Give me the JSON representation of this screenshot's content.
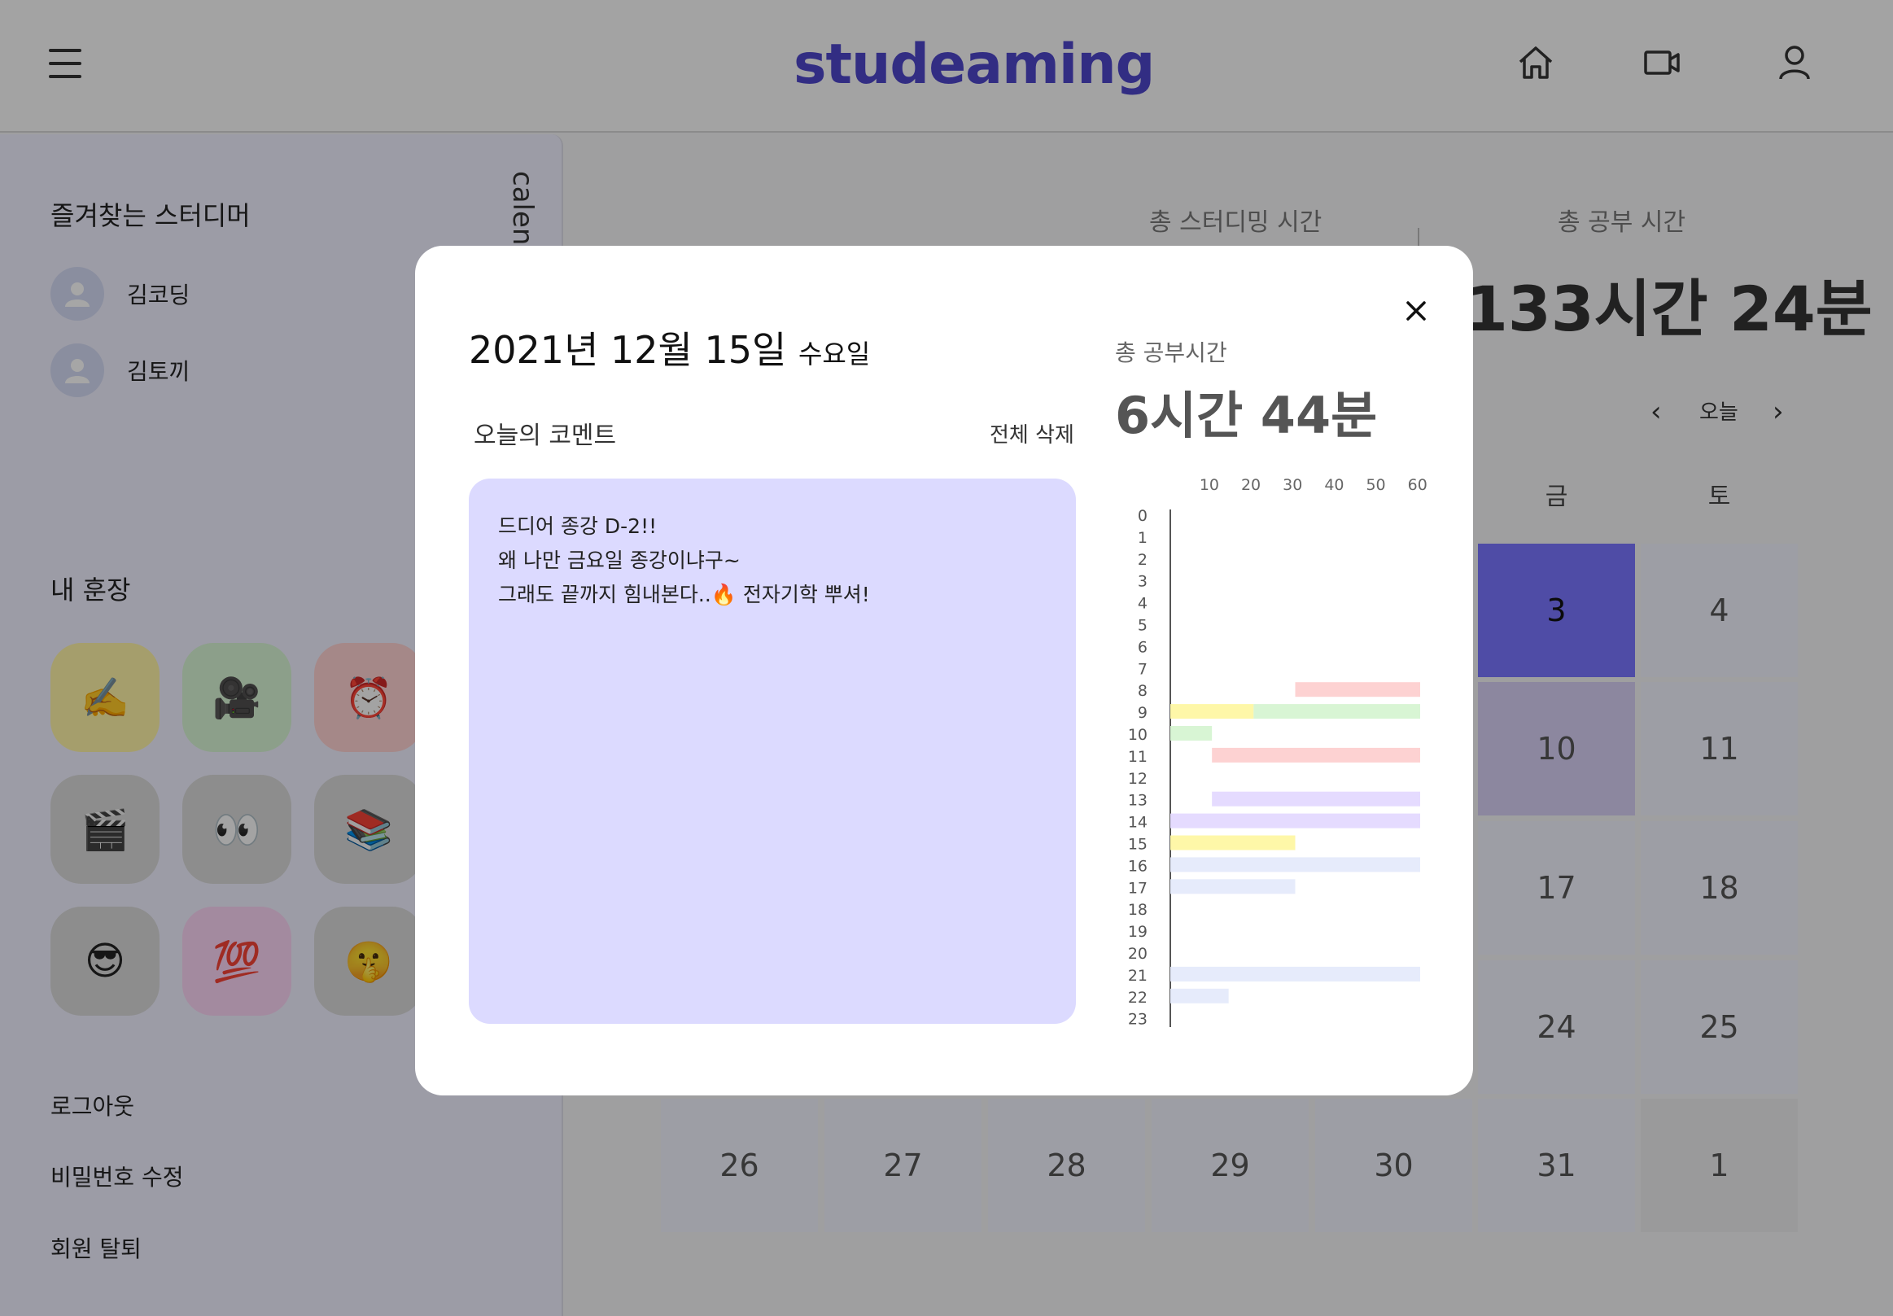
{
  "header": {
    "logo": "studeaming"
  },
  "sidebar": {
    "calendar_tab": "calendar",
    "favorites_title": "즐겨찾는 스터디머",
    "favorites": [
      {
        "name": "김코딩"
      },
      {
        "name": "김토끼"
      }
    ],
    "stamps_title": "내 훈장",
    "stamps": [
      {
        "emoji": "✍️",
        "color": "#fef3a6"
      },
      {
        "emoji": "🎥",
        "color": "#d8f5d4"
      },
      {
        "emoji": "⏰",
        "color": "#fdd2d2"
      },
      {
        "emoji": "🎬",
        "color": "#d9d9d9"
      },
      {
        "emoji": "👀",
        "color": "#d9d9d9"
      },
      {
        "emoji": "📚",
        "color": "#d9d9d9"
      },
      {
        "emoji": "😎",
        "color": "#d9d9d9"
      },
      {
        "emoji": "💯",
        "color": "#fbd4f4"
      },
      {
        "emoji": "🤫",
        "color": "#d9d9d9"
      }
    ],
    "menu": {
      "logout": "로그아웃",
      "change_password": "비밀번호 수정",
      "withdraw": "회원 탈퇴"
    }
  },
  "main": {
    "stat_studeaming_label": "총 스터디밍 시간",
    "stat_study_label": "총 공부 시간",
    "stat_study_value": "133시간 24분",
    "today_button": "오늘",
    "weekdays": {
      "fri": "금",
      "sat": "토"
    },
    "cells": [
      {
        "day": "3",
        "level": "high"
      },
      {
        "day": "4",
        "level": "none"
      },
      {
        "day": "10",
        "level": "mid"
      },
      {
        "day": "11",
        "level": "none"
      },
      {
        "day": "17",
        "level": "none"
      },
      {
        "day": "18",
        "level": "none"
      },
      {
        "day": "24",
        "level": "none"
      },
      {
        "day": "25",
        "level": "none"
      },
      {
        "day": "26",
        "level": "none"
      },
      {
        "day": "27",
        "level": "none"
      },
      {
        "day": "28",
        "level": "none"
      },
      {
        "day": "29",
        "level": "none"
      },
      {
        "day": "30",
        "level": "none"
      },
      {
        "day": "31",
        "level": "none"
      },
      {
        "day": "1",
        "level": "other"
      }
    ],
    "colors": {
      "high": "#7a75ff",
      "mid": "#d8d0f5",
      "none": "#f2f3fd",
      "other": "#ededef"
    }
  },
  "modal": {
    "date": "2021년 12월 15일",
    "weekday": "수요일",
    "comment_title": "오늘의 코멘트",
    "delete_all": "전체 삭제",
    "comment_lines": [
      "드디어 종강 D-2!!",
      "왜 나만 금요일 종강이냐구~",
      "그래도 끝까지 힘내본다..🔥 전자기학 뿌셔!"
    ],
    "total_label": "총 공부시간",
    "total_value": "6시간 44분"
  },
  "chart_data": {
    "type": "bar",
    "orientation": "horizontal",
    "xlim": [
      0,
      60
    ],
    "x_ticks": [
      "10",
      "20",
      "30",
      "40",
      "50",
      "60"
    ],
    "y_categories": [
      "0",
      "1",
      "2",
      "3",
      "4",
      "5",
      "6",
      "7",
      "8",
      "9",
      "10",
      "11",
      "12",
      "13",
      "14",
      "15",
      "16",
      "17",
      "18",
      "19",
      "20",
      "21",
      "22",
      "23"
    ],
    "segments": [
      {
        "hour": 8,
        "start": 30,
        "end": 60,
        "color": "#fdd2d2"
      },
      {
        "hour": 9,
        "start": 0,
        "end": 20,
        "color": "#fef7a8"
      },
      {
        "hour": 9,
        "start": 20,
        "end": 60,
        "color": "#d8f5d4"
      },
      {
        "hour": 10,
        "start": 0,
        "end": 10,
        "color": "#d8f5d4"
      },
      {
        "hour": 11,
        "start": 10,
        "end": 60,
        "color": "#fdd2d2"
      },
      {
        "hour": 13,
        "start": 10,
        "end": 60,
        "color": "#e5dbff"
      },
      {
        "hour": 14,
        "start": 0,
        "end": 60,
        "color": "#e5dbff"
      },
      {
        "hour": 15,
        "start": 0,
        "end": 30,
        "color": "#fef7a8"
      },
      {
        "hour": 16,
        "start": 0,
        "end": 60,
        "color": "#e6ebfb"
      },
      {
        "hour": 17,
        "start": 0,
        "end": 30,
        "color": "#e6ebfb"
      },
      {
        "hour": 21,
        "start": 0,
        "end": 60,
        "color": "#e6ebfb"
      },
      {
        "hour": 22,
        "start": 0,
        "end": 14,
        "color": "#e6ebfb"
      }
    ]
  }
}
